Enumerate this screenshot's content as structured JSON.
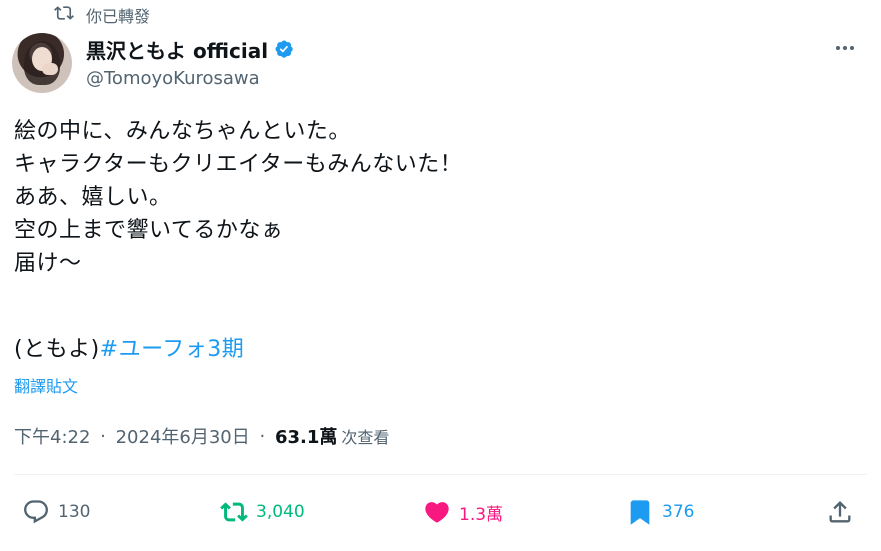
{
  "repost_notice": {
    "label": "你已轉發",
    "icon": "repost-icon"
  },
  "author": {
    "display_name": "黒沢ともよ official",
    "handle": "@TomoyoKurosawa",
    "verified": true,
    "verified_color": "#1d9bf0"
  },
  "tweet": {
    "lines": [
      "絵の中に、みんなちゃんといた。",
      "キャラクターもクリエイターもみんないた！",
      "ああ、嬉しい。",
      "空の上まで響いてるかなぁ",
      "届け〜"
    ],
    "signature_prefix": "(ともよ)",
    "hashtag": "#ユーフォ3期",
    "translate_label": "翻譯貼文"
  },
  "meta": {
    "time": "下午4:22",
    "separator": " · ",
    "date": "2024年6月30日",
    "views_count": "63.1萬",
    "views_label": "次查看"
  },
  "actions": {
    "replies": "130",
    "reposts": "3,040",
    "likes": "1.3萬",
    "bookmarks": "376"
  },
  "colors": {
    "text": "#0f1419",
    "secondary": "#536471",
    "link": "#1d9bf0",
    "repost_active": "#00ba7c",
    "like_active": "#f91880"
  }
}
